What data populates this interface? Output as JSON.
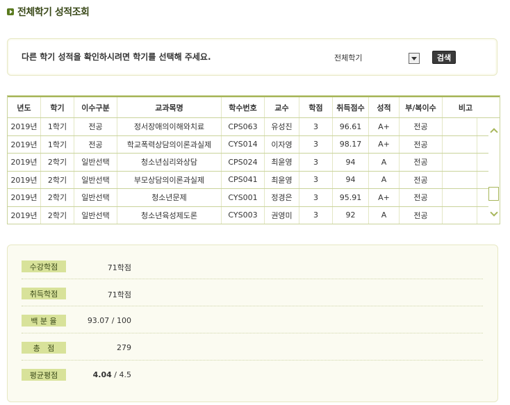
{
  "title": "전체학기 성적조회",
  "search": {
    "message": "다른 학기 성적을 확인하시려면 학기를 선택해 주세요.",
    "semester_selected": "전체학기",
    "button_label": "검색"
  },
  "grades": {
    "headers": [
      "년도",
      "학기",
      "이수구분",
      "교과목명",
      "학수번호",
      "교수",
      "학점",
      "취득점수",
      "성적",
      "부/복이수",
      "비고"
    ],
    "rows": [
      {
        "year": "2019년",
        "term": "1학기",
        "type": "전공",
        "course": "정서장애의이해와치료",
        "code": "CPS063",
        "prof": "유성진",
        "credit": "3",
        "score": "96.61",
        "grade": "A+",
        "minor": "전공",
        "note": ""
      },
      {
        "year": "2019년",
        "term": "1학기",
        "type": "전공",
        "course": "학교폭력상담의이론과실제",
        "code": "CYS014",
        "prof": "이자영",
        "credit": "3",
        "score": "98.17",
        "grade": "A+",
        "minor": "전공",
        "note": ""
      },
      {
        "year": "2019년",
        "term": "2학기",
        "type": "일반선택",
        "course": "청소년심리와상담",
        "code": "CPS024",
        "prof": "최윤영",
        "credit": "3",
        "score": "94",
        "grade": "A",
        "minor": "전공",
        "note": ""
      },
      {
        "year": "2019년",
        "term": "2학기",
        "type": "일반선택",
        "course": "부모상담의이론과실제",
        "code": "CPS041",
        "prof": "최윤영",
        "credit": "3",
        "score": "94",
        "grade": "A",
        "minor": "전공",
        "note": ""
      },
      {
        "year": "2019년",
        "term": "2학기",
        "type": "일반선택",
        "course": "청소년문제",
        "code": "CYS001",
        "prof": "정경은",
        "credit": "3",
        "score": "95.91",
        "grade": "A+",
        "minor": "전공",
        "note": ""
      },
      {
        "year": "2019년",
        "term": "2학기",
        "type": "일반선택",
        "course": "청소년육성제도론",
        "code": "CYS003",
        "prof": "권영미",
        "credit": "3",
        "score": "92",
        "grade": "A",
        "minor": "전공",
        "note": ""
      }
    ]
  },
  "summary": {
    "taken_label": "수강학점",
    "taken_value": "71학점",
    "earned_label": "취득학점",
    "earned_value": "71학점",
    "percent_label": "백 분 율",
    "percent_value": "93.07 / 100",
    "total_label": "총   점",
    "total_value": "279",
    "gpa_label": "평균평점",
    "gpa_value": "4.04",
    "gpa_max": " / 4.5"
  },
  "colors": {
    "accent": "#a7b65a",
    "label_bg": "#d8e29a",
    "title": "#3b4a1a"
  }
}
